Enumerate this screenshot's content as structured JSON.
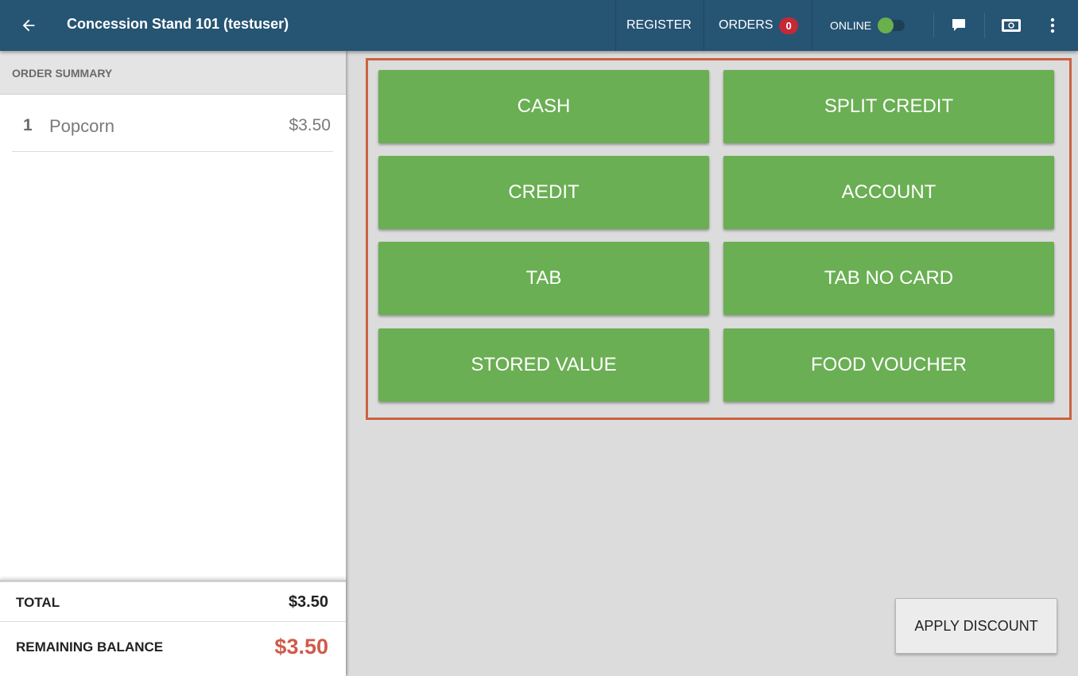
{
  "header": {
    "title": "Concession Stand 101 (testuser)",
    "register_label": "REGISTER",
    "orders_label": "ORDERS",
    "orders_count": "0",
    "online_label": "ONLINE",
    "online_enabled": true
  },
  "order_summary": {
    "heading": "ORDER SUMMARY",
    "items": [
      {
        "qty": "1",
        "name": "Popcorn",
        "price": "$3.50"
      }
    ],
    "total_label": "TOTAL",
    "total_value": "$3.50",
    "remaining_label": "REMAINING BALANCE",
    "remaining_value": "$3.50"
  },
  "payment_buttons": [
    "CASH",
    "SPLIT CREDIT",
    "CREDIT",
    "ACCOUNT",
    "TAB",
    "TAB NO CARD",
    "STORED VALUE",
    "FOOD VOUCHER"
  ],
  "apply_discount_label": "APPLY DISCOUNT",
  "colors": {
    "topbar": "#265473",
    "pay_button": "#6aaf53",
    "highlight_frame": "#cc6140",
    "orders_badge": "#c62835",
    "remaining_balance": "#cf5a4b"
  },
  "icons": [
    "back-arrow-icon",
    "chat-bubble-icon",
    "cash-drawer-icon",
    "more-vert-icon"
  ]
}
